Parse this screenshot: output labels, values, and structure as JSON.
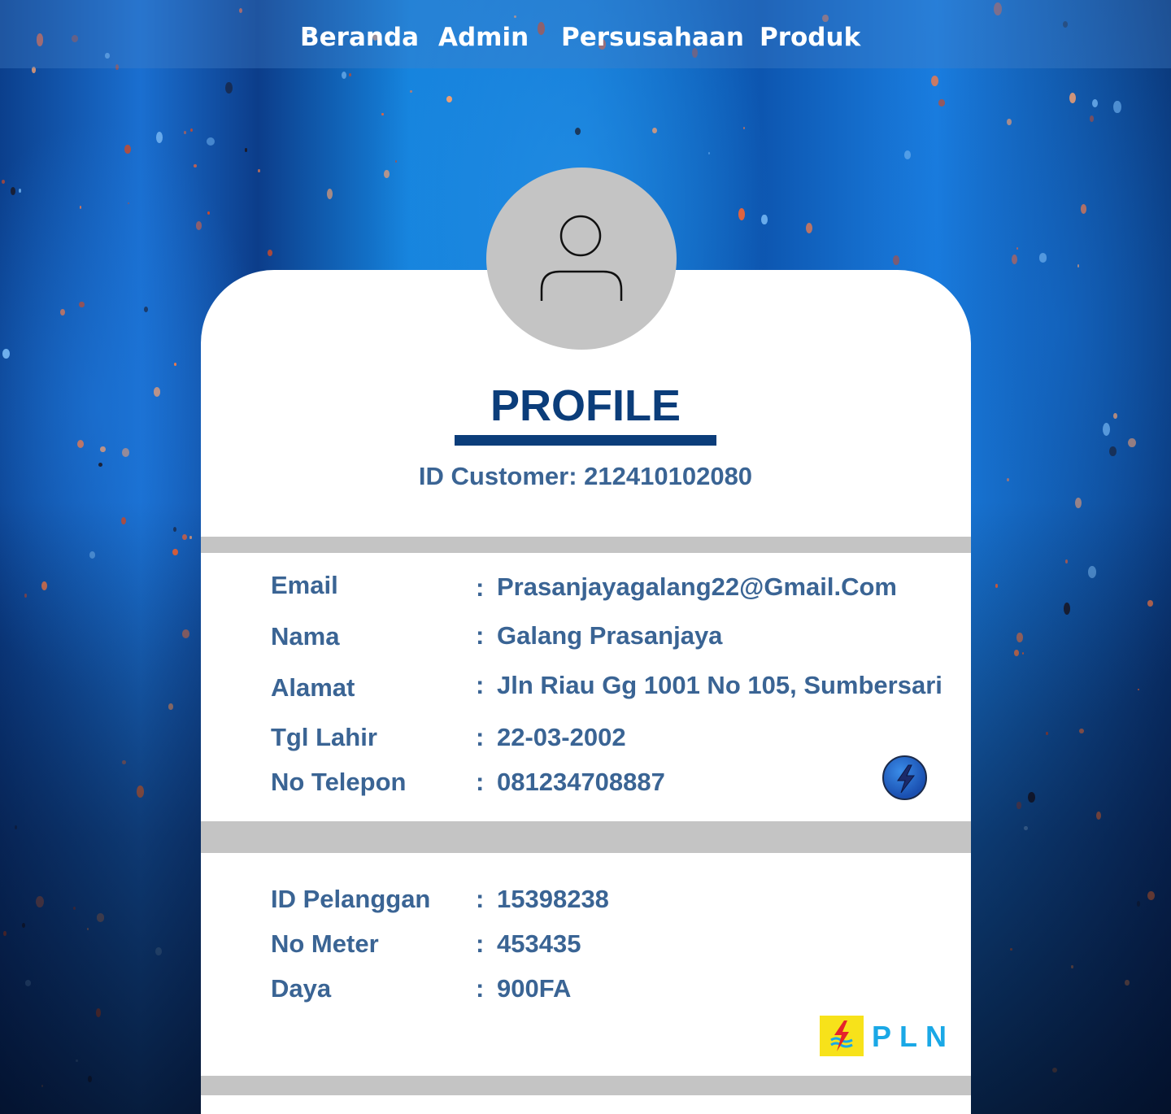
{
  "nav": {
    "items": [
      {
        "label": "Beranda"
      },
      {
        "label": "Admin"
      },
      {
        "label": "Persusahaan"
      },
      {
        "label": "Produk"
      }
    ]
  },
  "profile": {
    "title": "PROFILE",
    "customer_id_text": "ID Customer: 212410102080"
  },
  "personal": [
    {
      "label": "Email",
      "value": "Prasanjayagalang22@Gmail.Com"
    },
    {
      "label": "Nama",
      "value": "Galang Prasanjaya"
    },
    {
      "label": "Alamat",
      "value": "Jln Riau Gg 1001 No 105, Sumbersari"
    },
    {
      "label": "Tgl Lahir",
      "value": "22-03-2002"
    },
    {
      "label": "No Telepon",
      "value": "081234708887"
    }
  ],
  "meter": [
    {
      "label": "ID Pelanggan",
      "value": "15398238"
    },
    {
      "label": "No Meter",
      "value": "453435"
    },
    {
      "label": "Daya",
      "value": "900FA"
    }
  ],
  "separator": ":",
  "brand": {
    "logo_text": "PLN",
    "logo_icon": "pln-logo-icon",
    "badge_icon": "lightning-bolt-icon"
  },
  "colors": {
    "primary": "#0b3d7a",
    "text": "#3a6494",
    "divider": "#c4c4c4",
    "pln_blue": "#1aa8e6",
    "pln_yellow": "#f7e21a"
  }
}
